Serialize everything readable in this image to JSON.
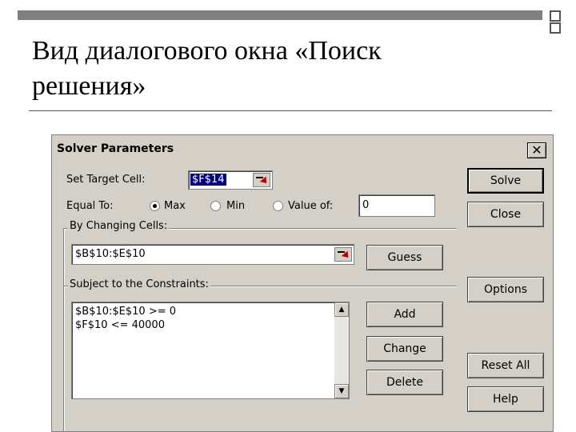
{
  "slide": {
    "title_line1": "Вид диалогового окна «Поиск",
    "title_line2": "решения»"
  },
  "dialog": {
    "title": "Solver Parameters",
    "close_glyph": "✕",
    "set_target_label": "Set Target Cell:",
    "set_target_value": "$F$14",
    "equal_to_label": "Equal To:",
    "options": {
      "max": "Max",
      "min": "Min",
      "value_of": "Value of:",
      "selected": "Max"
    },
    "value_of_input": "0",
    "changing_cells_label": "By Changing Cells:",
    "changing_cells_value": "$B$10:$E$10",
    "constraints_label": "Subject to the Constraints:",
    "constraints": [
      "$B$10:$E$10 >= 0",
      "$F$10 <= 40000"
    ],
    "buttons": {
      "solve": "Solve",
      "close": "Close",
      "guess": "Guess",
      "options": "Options",
      "add": "Add",
      "change": "Change",
      "delete": "Delete",
      "reset_all": "Reset All",
      "help": "Help"
    }
  }
}
